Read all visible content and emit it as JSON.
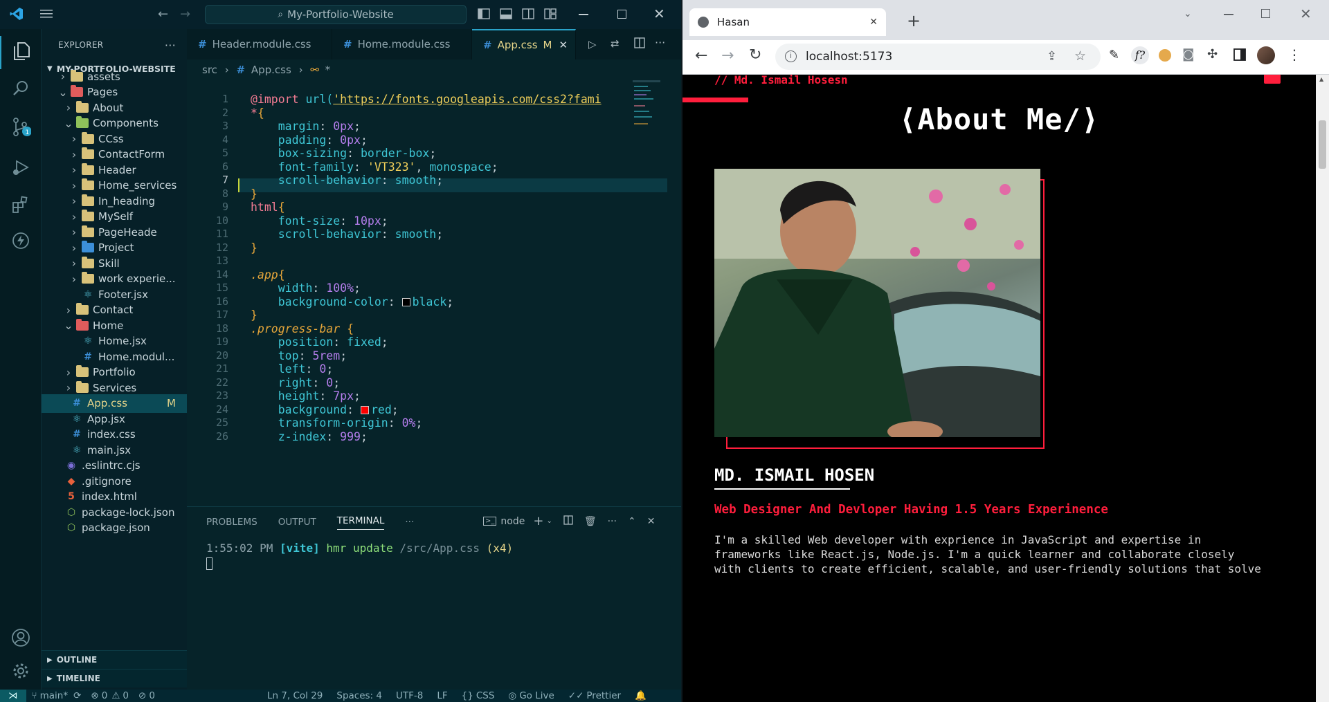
{
  "vscode": {
    "search_title": "My-Portfolio-Website",
    "explorer_title": "EXPLORER",
    "project_name": "MY-PORTFOLIO-WEBSITE",
    "tree": [
      {
        "label": "assets",
        "type": "folder",
        "color": "gold",
        "depth": 1,
        "open": false
      },
      {
        "label": "Pages",
        "type": "folder",
        "color": "red",
        "depth": 1,
        "open": true
      },
      {
        "label": "About",
        "type": "folder",
        "color": "gold",
        "depth": 2,
        "open": false
      },
      {
        "label": "Components",
        "type": "folder",
        "color": "green",
        "depth": 2,
        "open": true
      },
      {
        "label": "CCss",
        "type": "folder",
        "color": "gold",
        "depth": 3,
        "open": false
      },
      {
        "label": "ContactForm",
        "type": "folder",
        "color": "gold",
        "depth": 3,
        "open": false
      },
      {
        "label": "Header",
        "type": "folder",
        "color": "gold",
        "depth": 3,
        "open": false
      },
      {
        "label": "Home_services",
        "type": "folder",
        "color": "gold",
        "depth": 3,
        "open": false
      },
      {
        "label": "In_heading",
        "type": "folder",
        "color": "gold",
        "depth": 3,
        "open": false
      },
      {
        "label": "MySelf",
        "type": "folder",
        "color": "gold",
        "depth": 3,
        "open": false
      },
      {
        "label": "PageHeade",
        "type": "folder",
        "color": "gold",
        "depth": 3,
        "open": false
      },
      {
        "label": "Project",
        "type": "folder",
        "color": "blue",
        "depth": 3,
        "open": false
      },
      {
        "label": "Skill",
        "type": "folder",
        "color": "gold",
        "depth": 3,
        "open": false
      },
      {
        "label": "work experie...",
        "type": "folder",
        "color": "gold",
        "depth": 3,
        "open": false
      },
      {
        "label": "Footer.jsx",
        "type": "react",
        "depth": 3
      },
      {
        "label": "Contact",
        "type": "folder",
        "color": "gold",
        "depth": 2,
        "open": false
      },
      {
        "label": "Home",
        "type": "folder",
        "color": "red",
        "depth": 2,
        "open": true
      },
      {
        "label": "Home.jsx",
        "type": "react",
        "depth": 3
      },
      {
        "label": "Home.modul...",
        "type": "css",
        "depth": 3
      },
      {
        "label": "Portfolio",
        "type": "folder",
        "color": "gold",
        "depth": 2,
        "open": false
      },
      {
        "label": "Services",
        "type": "folder",
        "color": "gold",
        "depth": 2,
        "open": false
      },
      {
        "label": "App.css",
        "type": "css",
        "depth": 1,
        "selected": true,
        "badge": "M"
      },
      {
        "label": "App.jsx",
        "type": "react",
        "depth": 1
      },
      {
        "label": "index.css",
        "type": "css",
        "depth": 1
      },
      {
        "label": "main.jsx",
        "type": "react",
        "depth": 1
      },
      {
        "label": ".eslintrc.cjs",
        "type": "eslint",
        "depth": 0
      },
      {
        "label": ".gitignore",
        "type": "git",
        "depth": 0
      },
      {
        "label": "index.html",
        "type": "html",
        "depth": 0
      },
      {
        "label": "package-lock.json",
        "type": "json",
        "depth": 0
      },
      {
        "label": "package.json",
        "type": "json",
        "depth": 0
      }
    ],
    "outline_label": "OUTLINE",
    "timeline_label": "TIMELINE",
    "tabs": [
      {
        "label": "Header.module.css",
        "active": false
      },
      {
        "label": "Home.module.css",
        "active": false
      },
      {
        "label": "App.css",
        "active": true,
        "badge": "M"
      }
    ],
    "breadcrumb": [
      "src",
      "App.css",
      "*"
    ],
    "code_line_numbers": [
      "1",
      "2",
      "3",
      "4",
      "5",
      "6",
      "7",
      "8",
      "9",
      "10",
      "11",
      "12",
      "13",
      "14",
      "15",
      "16",
      "17",
      "18",
      "19",
      "20",
      "21",
      "22",
      "23",
      "24",
      "25",
      "26"
    ],
    "panel_tabs": [
      "PROBLEMS",
      "OUTPUT",
      "TERMINAL"
    ],
    "terminal_shell": "node",
    "terminal_line": {
      "time": "1:55:02 PM",
      "tag": "[vite]",
      "msg": "hmr update",
      "path": "/src/App.css",
      "count": "(x4)"
    },
    "status": {
      "branch": "main*",
      "errors": "0",
      "warnings": "0",
      "ports": "0",
      "position": "Ln 7, Col 29",
      "spaces": "Spaces: 4",
      "encoding": "UTF-8",
      "eol": "LF",
      "language": "CSS",
      "golive": "Go Live",
      "prettier": "Prettier"
    }
  },
  "browser": {
    "tab_title": "Hasan",
    "url": "localhost:5173",
    "page": {
      "top_label": "// Md. Ismail Hosesn",
      "heading": "⟨About Me/⟩",
      "name": "MD. ISMAIL HOSEN",
      "tagline": "Web Designer And Devloper Having 1.5 Years Experinence",
      "bio_lines": [
        "I'm a skilled Web developer with exprience in JavaScript and expertise in",
        "frameworks like React.js, Node.js. I'm a quick learner and collaborate closely",
        "with clients to create efficient, scalable, and user-friendly solutions that solve"
      ]
    }
  },
  "colors": {
    "accent_red": "#ff1e3c",
    "editor_bg": "#062329",
    "terminal_green": "#8fe07a"
  }
}
